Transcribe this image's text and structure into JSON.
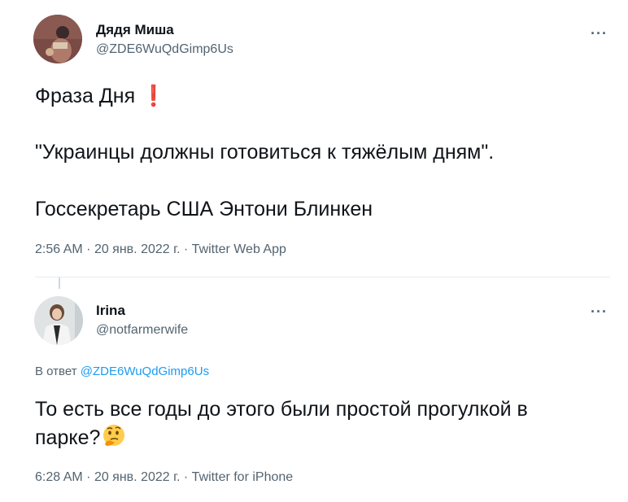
{
  "tweet1": {
    "name": "Дядя Миша",
    "handle": "@ZDE6WuQdGimp6Us",
    "more": "···",
    "lines": [
      "Фраза Дня",
      "\"Украинцы должны готовиться к тяжёлым дням\".",
      "Госсекретарь США Энтони Блинкен"
    ],
    "exclaim": "❗",
    "time": "2:56 AM",
    "date": "20 янв. 2022 г.",
    "source": "Twitter Web App",
    "sep": "·"
  },
  "tweet2": {
    "name": "Irina",
    "handle": "@notfarmerwife",
    "more": "···",
    "reply_prefix": "В ответ",
    "reply_mention": "@ZDE6WuQdGimp6Us",
    "line1": "То есть все годы до этого были простой прогулкой в",
    "line2": "парке?",
    "emoji": "thinking-face-icon",
    "time": "6:28 AM",
    "date": "20 янв. 2022 г.",
    "source": "Twitter for iPhone",
    "sep": "·"
  },
  "colors": {
    "text": "#0f1419",
    "secondary": "#536471",
    "link": "#1d9bf0",
    "divider": "#e6ecf0",
    "exclaim": "#e0245e"
  }
}
